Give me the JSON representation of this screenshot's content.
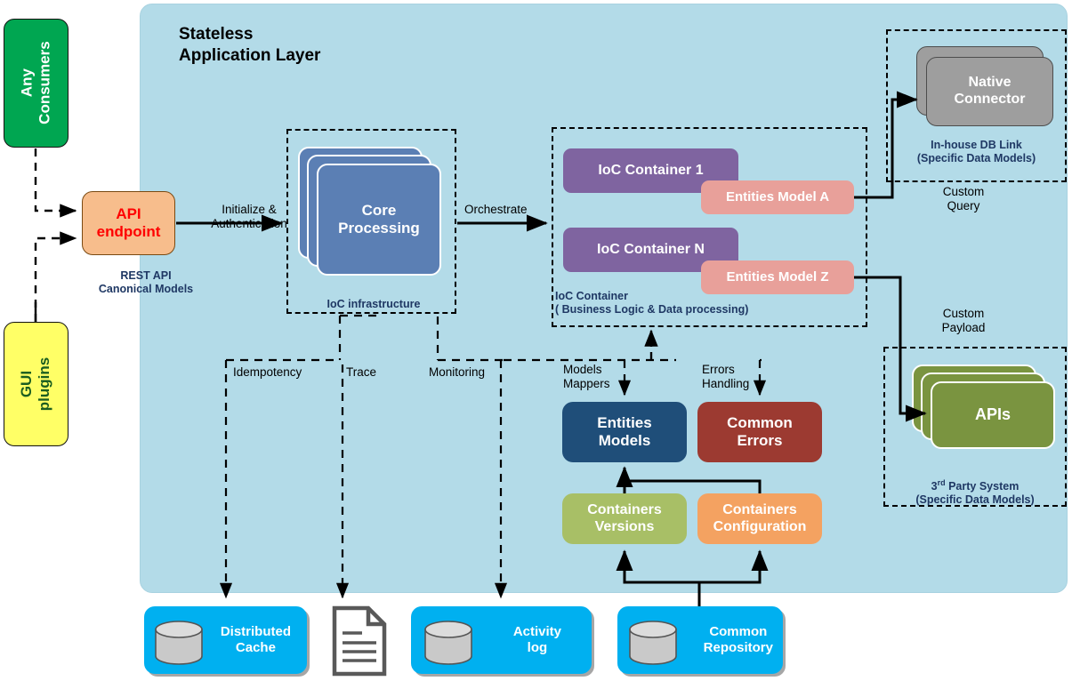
{
  "diagram": {
    "panel_title": "Stateless\nApplication Layer"
  },
  "external": {
    "any_consumers": "Any\nConsumers",
    "gui_plugins": "GUI\nplugins"
  },
  "api": {
    "endpoint_label": "API\nendpoint",
    "endpoint_caption": "REST API\nCanonical Models",
    "edge_to_core": "Initialize &\nAuthentication"
  },
  "core": {
    "label": "Core\nProcessing",
    "group_label": "IoC infrastructure",
    "edge_orchestrate": "Orchestrate"
  },
  "ioc": {
    "group_label": "IoC Container\n( Business Logic & Data processing)",
    "container_1": "IoC Container 1",
    "container_n": "IoC Container N",
    "entities_model_a": "Entities Model A",
    "entities_model_z": "Entities Model Z"
  },
  "right": {
    "native_connector": "Native\nConnector",
    "native_caption": "In-house DB Link\n(Specific Data Models)",
    "apis": "APIs",
    "apis_caption_sup": "3",
    "apis_caption_sup_ord": "rd",
    "apis_caption": " Party System\n(Specific Data Models)",
    "edge_custom_query": "Custom\nQuery",
    "edge_custom_payload": "Custom\nPayload"
  },
  "middle": {
    "entities_models": "Entities\nModels",
    "common_errors": "Common\nErrors",
    "containers_versions": "Containers\nVersions",
    "containers_configuration": "Containers\nConfiguration",
    "edge_models_mappers": "Models\nMappers",
    "edge_errors_handling": "Errors\nHandling"
  },
  "crosscut": {
    "idempotency": "Idempotency",
    "trace": "Trace",
    "monitoring": "Monitoring"
  },
  "stores": {
    "distributed_cache": "Distributed\nCache",
    "activity_log": "Activity\nlog",
    "common_repository": "Common\nRepository"
  },
  "colors": {
    "panel": "#b3dbe8",
    "consumers_green": "#00a651",
    "gui_yellow": "#ffff66",
    "api_orange": "#f7bd8c",
    "api_text_red": "#ff0000",
    "core_blue": "#5b7fb4",
    "ioc_purple": "#7f64a0",
    "entities_pink": "#e8a09a",
    "native_gray": "#9e9e9e",
    "apis_olive": "#7a9440",
    "entities_models_navy": "#1f4e79",
    "common_errors_maroon": "#9c3a31",
    "versions_green": "#a8bf66",
    "config_orange": "#f4a261",
    "store_cyan": "#00b0f0",
    "dash_label_blue": "#1f3864"
  }
}
